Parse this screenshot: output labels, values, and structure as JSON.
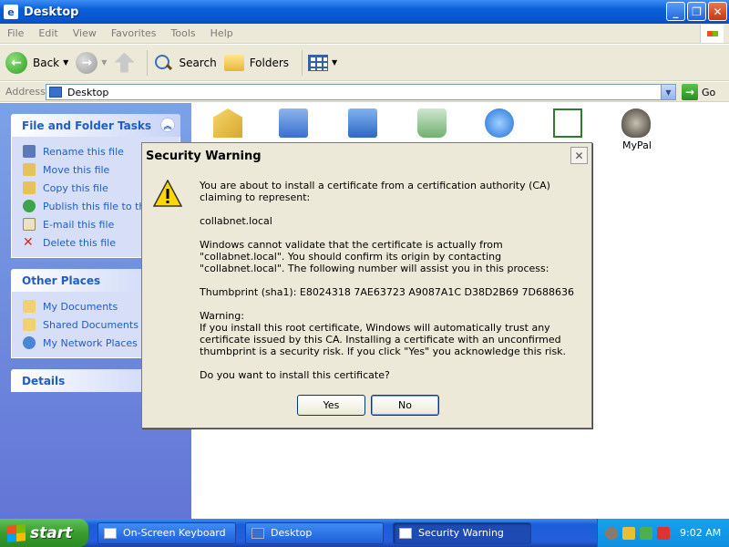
{
  "window": {
    "title": "Desktop"
  },
  "menu": [
    "File",
    "Edit",
    "View",
    "Favorites",
    "Tools",
    "Help"
  ],
  "toolbar": {
    "back": "Back",
    "search": "Search",
    "folders": "Folders"
  },
  "address": {
    "label": "Address",
    "value": "Desktop",
    "go": "Go"
  },
  "tasks_panel": {
    "title": "File and Folder Tasks",
    "items": [
      "Rename this file",
      "Move this file",
      "Copy this file",
      "Publish this file to the Web",
      "E-mail this file",
      "Delete this file"
    ]
  },
  "places_panel": {
    "title": "Other Places",
    "items": [
      "My Documents",
      "Shared Documents",
      "My Network Places"
    ]
  },
  "details_panel": {
    "title": "Details"
  },
  "desktop": {
    "mypal_label": "MyPal"
  },
  "dialog": {
    "title": "Security Warning",
    "p1": "You are about to install a certificate from a certification authority (CA) claiming to represent:",
    "p2": "collabnet.local",
    "p3": "Windows cannot validate that the certificate is actually from \"collabnet.local\". You should confirm its origin by contacting \"collabnet.local\". The following number will assist you in this process:",
    "p4": "Thumbprint (sha1): E8024318 7AE63723 A9087A1C D38D2B69 7D688636",
    "p5": "Warning:\nIf you install this root certificate, Windows will automatically trust any certificate issued by this CA. Installing a certificate with an unconfirmed thumbprint is a security risk. If you click \"Yes\" you acknowledge this risk.",
    "p6": "Do you want to install this certificate?",
    "yes": "Yes",
    "no": "No"
  },
  "taskbar": {
    "start": "start",
    "tasks": [
      "On-Screen Keyboard",
      "Desktop",
      "Security Warning"
    ],
    "clock": "9:02 AM"
  }
}
